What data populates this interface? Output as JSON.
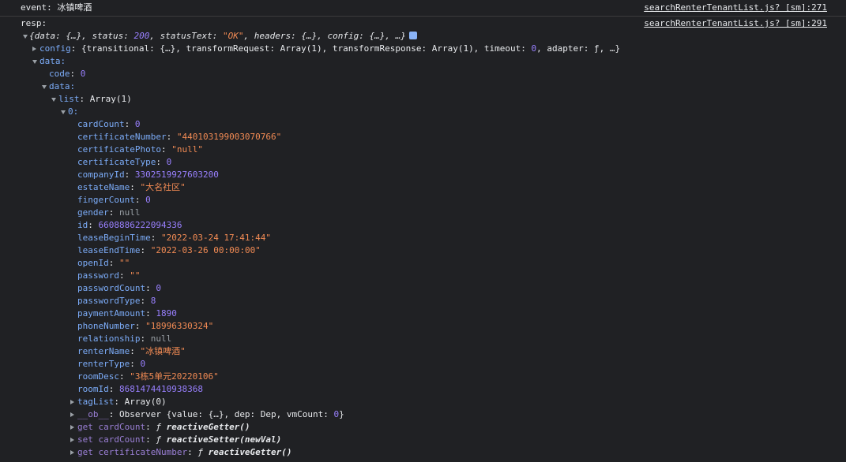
{
  "messages": [
    {
      "label": "event:",
      "value": "冰镇啤酒",
      "source": "searchRenterTenantList.js? [sm]:271"
    },
    {
      "label": "resp:",
      "value": "",
      "source": "searchRenterTenantList.js? [sm]:291"
    }
  ],
  "root_summary": {
    "open": "{data: {…}, status: ",
    "status": "200",
    "mid": ", statusText: ",
    "statusText": "\"OK\"",
    "tail": ", headers: {…}, config: {…}, …}"
  },
  "config_row": {
    "key": "config",
    "pre": ": {transitional: {…}, transformRequest: Array(1), transformResponse: Array(1), timeout: ",
    "timeout": "0",
    "post": ", adapter: ƒ, …}"
  },
  "data_key": "data:",
  "code_row": {
    "key": "code",
    "value": "0"
  },
  "inner_data_key": "data:",
  "list_row": {
    "key": "list",
    "value": "Array(1)"
  },
  "item_key": "0:",
  "fields": [
    {
      "key": "cardCount",
      "value": "0",
      "type": "num"
    },
    {
      "key": "certificateNumber",
      "value": "\"440103199003070766\"",
      "type": "str"
    },
    {
      "key": "certificatePhoto",
      "value": "\"null\"",
      "type": "str"
    },
    {
      "key": "certificateType",
      "value": "0",
      "type": "num"
    },
    {
      "key": "companyId",
      "value": "3302519927603200",
      "type": "num"
    },
    {
      "key": "estateName",
      "value": "\"大名社区\"",
      "type": "str"
    },
    {
      "key": "fingerCount",
      "value": "0",
      "type": "num"
    },
    {
      "key": "gender",
      "value": "null",
      "type": "nul"
    },
    {
      "key": "id",
      "value": "6608886222094336",
      "type": "num"
    },
    {
      "key": "leaseBeginTime",
      "value": "\"2022-03-24 17:41:44\"",
      "type": "str"
    },
    {
      "key": "leaseEndTime",
      "value": "\"2022-03-26 00:00:00\"",
      "type": "str"
    },
    {
      "key": "openId",
      "value": "\"\"",
      "type": "str"
    },
    {
      "key": "password",
      "value": "\"\"",
      "type": "str"
    },
    {
      "key": "passwordCount",
      "value": "0",
      "type": "num"
    },
    {
      "key": "passwordType",
      "value": "8",
      "type": "num"
    },
    {
      "key": "paymentAmount",
      "value": "1890",
      "type": "num"
    },
    {
      "key": "phoneNumber",
      "value": "\"18996330324\"",
      "type": "str"
    },
    {
      "key": "relationship",
      "value": "null",
      "type": "nul"
    },
    {
      "key": "renterName",
      "value": "\"冰镇啤酒\"",
      "type": "str"
    },
    {
      "key": "renterType",
      "value": "0",
      "type": "num"
    },
    {
      "key": "roomDesc",
      "value": "\"3栋5单元20220106\"",
      "type": "str"
    },
    {
      "key": "roomId",
      "value": "8681474410938368",
      "type": "num"
    }
  ],
  "tagList_row": {
    "key": "tagList",
    "value": "Array(0)"
  },
  "ob_row": {
    "key": "__ob__",
    "pre": ": Observer {value: {…}, dep: Dep, vmCount: ",
    "count": "0",
    "post": "}"
  },
  "getters": [
    {
      "key": "get cardCount",
      "fn": "ƒ ",
      "name": "reactiveGetter()"
    },
    {
      "key": "set cardCount",
      "fn": "ƒ ",
      "name": "reactiveSetter(newVal)"
    },
    {
      "key": "get certificateNumber",
      "fn": "ƒ ",
      "name": "reactiveGetter()"
    }
  ]
}
